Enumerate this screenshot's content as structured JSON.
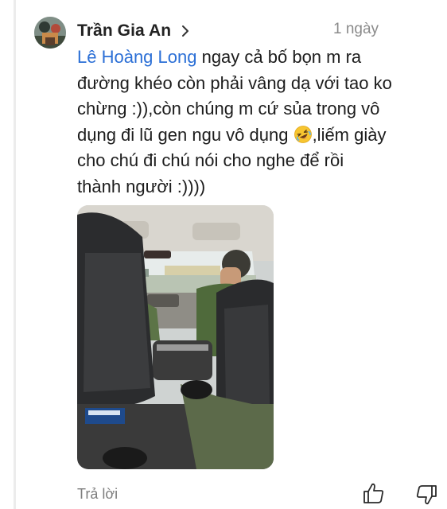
{
  "comment": {
    "author": "Trần Gia An",
    "timestamp": "1 ngày",
    "mention": "Lê Hoàng Long",
    "lines": [
      " ngay cả bố bọn m ra",
      "đường khéo còn phải vâng dạ với tao ko",
      "chừng :)),còn chúng m cứ sủa trong vô",
      "dụng đi lũ gen ngu vô dụng ",
      ",liếm giày",
      "cho chú đi chú nói cho nghe để rồi",
      "thành người :))))"
    ],
    "emoji": "rolling-on-floor-laughing-emoji",
    "photo": "car-interior-photo"
  },
  "actions": {
    "reply_label": "Trả lời",
    "like_icon": "thumbs-up-icon",
    "dislike_icon": "thumbs-down-icon"
  },
  "colors": {
    "mention": "#2b6fd6",
    "author": "#222222",
    "meta": "#8a8a8a",
    "text": "#1c1c1c"
  }
}
